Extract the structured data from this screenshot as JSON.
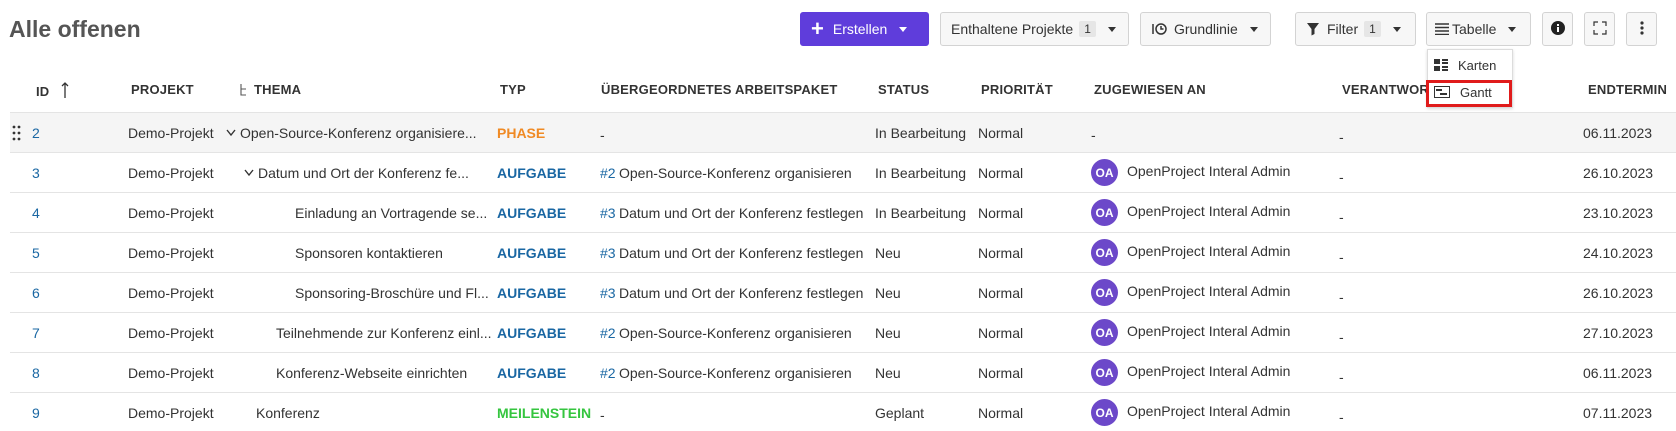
{
  "page_title": "Alle offenen",
  "toolbar": {
    "create_label": "Erstellen",
    "projects_label": "Enthaltene Projekte",
    "projects_count": "1",
    "baseline_label": "Grundlinie",
    "filter_label": "Filter",
    "filter_count": "1",
    "view_label": "Tabelle"
  },
  "view_menu": {
    "cards_label": "Karten",
    "gantt_label": "Gantt"
  },
  "columns": {
    "id": "ID",
    "project": "PROJEKT",
    "subject": "THEMA",
    "type": "TYP",
    "parent": "ÜBERGEORDNETES ARBEITSPAKET",
    "status": "STATUS",
    "priority": "PRIORITÄT",
    "assignee": "ZUGEWIESEN AN",
    "accountable": "VERANTWORTLICH",
    "finish": "ENDTERMIN"
  },
  "rows": [
    {
      "id": "2",
      "project": "Demo-Projekt",
      "subject": "Open-Source-Konferenz organisiere...",
      "type": "PHASE",
      "parent_ref": "",
      "parent": "-",
      "status": "In Bearbeitung",
      "priority": "Normal",
      "assignee_initials": "",
      "assignee": "-",
      "accountable": "-",
      "finish": "06.11.2023"
    },
    {
      "id": "3",
      "project": "Demo-Projekt",
      "subject": "Datum und Ort der Konferenz fe...",
      "type": "AUFGABE",
      "parent_ref": "#2",
      "parent": "Open-Source-Konferenz organisieren",
      "status": "In Bearbeitung",
      "priority": "Normal",
      "assignee_initials": "OA",
      "assignee": "OpenProject Interal Admin",
      "accountable": "-",
      "finish": "26.10.2023"
    },
    {
      "id": "4",
      "project": "Demo-Projekt",
      "subject": "Einladung an Vortragende se...",
      "type": "AUFGABE",
      "parent_ref": "#3",
      "parent": "Datum und Ort der Konferenz festlegen",
      "status": "In Bearbeitung",
      "priority": "Normal",
      "assignee_initials": "OA",
      "assignee": "OpenProject Interal Admin",
      "accountable": "-",
      "finish": "23.10.2023"
    },
    {
      "id": "5",
      "project": "Demo-Projekt",
      "subject": "Sponsoren kontaktieren",
      "type": "AUFGABE",
      "parent_ref": "#3",
      "parent": "Datum und Ort der Konferenz festlegen",
      "status": "Neu",
      "priority": "Normal",
      "assignee_initials": "OA",
      "assignee": "OpenProject Interal Admin",
      "accountable": "-",
      "finish": "24.10.2023"
    },
    {
      "id": "6",
      "project": "Demo-Projekt",
      "subject": "Sponsoring-Broschüre und Fl...",
      "type": "AUFGABE",
      "parent_ref": "#3",
      "parent": "Datum und Ort der Konferenz festlegen",
      "status": "Neu",
      "priority": "Normal",
      "assignee_initials": "OA",
      "assignee": "OpenProject Interal Admin",
      "accountable": "-",
      "finish": "26.10.2023"
    },
    {
      "id": "7",
      "project": "Demo-Projekt",
      "subject": "Teilnehmende zur Konferenz einl...",
      "type": "AUFGABE",
      "parent_ref": "#2",
      "parent": "Open-Source-Konferenz organisieren",
      "status": "Neu",
      "priority": "Normal",
      "assignee_initials": "OA",
      "assignee": "OpenProject Interal Admin",
      "accountable": "-",
      "finish": "27.10.2023"
    },
    {
      "id": "8",
      "project": "Demo-Projekt",
      "subject": "Konferenz-Webseite einrichten",
      "type": "AUFGABE",
      "parent_ref": "#2",
      "parent": "Open-Source-Konferenz organisieren",
      "status": "Neu",
      "priority": "Normal",
      "assignee_initials": "OA",
      "assignee": "OpenProject Interal Admin",
      "accountable": "-",
      "finish": "06.11.2023"
    },
    {
      "id": "9",
      "project": "Demo-Projekt",
      "subject": "Konferenz",
      "type": "MEILENSTEIN",
      "parent_ref": "",
      "parent": "-",
      "status": "Geplant",
      "priority": "Normal",
      "assignee_initials": "OA",
      "assignee": "OpenProject Interal Admin",
      "accountable": "-",
      "finish": "07.11.2023"
    }
  ],
  "colors": {
    "primary": "#5f3ddb",
    "phase": "#f08a24",
    "task": "#1a67a3",
    "milestone": "#35c53f",
    "avatar": "#6c48c9",
    "highlight": "#e01b1b"
  }
}
